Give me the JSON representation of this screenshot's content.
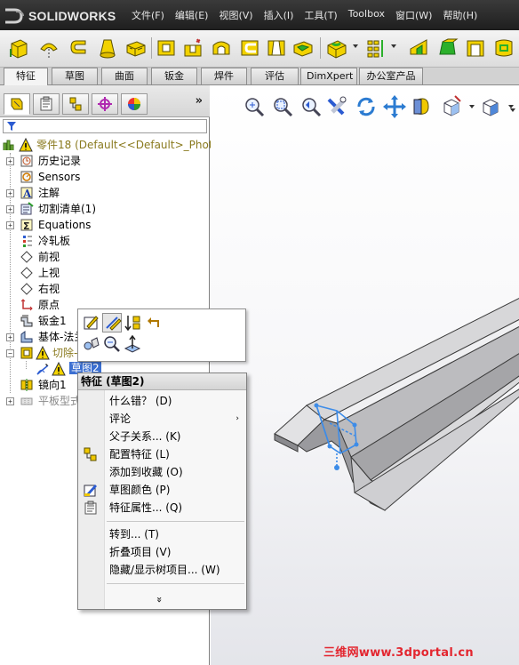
{
  "app": {
    "logo_prefix": "DS",
    "logo_name": "SOLIDWORKS"
  },
  "menu": {
    "items": [
      "文件(F)",
      "编辑(E)",
      "视图(V)",
      "插入(I)",
      "工具(T)",
      "Toolbox",
      "窗口(W)",
      "帮助(H)"
    ]
  },
  "command_tabs": [
    "特征",
    "草图",
    "曲面",
    "钣金",
    "焊件",
    "评估",
    "DimXpert",
    "办公室产品"
  ],
  "panel": {
    "more_glyph": "»",
    "tabs": [
      "feature-manager",
      "property-manager",
      "configuration-manager",
      "dimxpert-manager",
      "display-manager"
    ]
  },
  "tree": {
    "root_label": "零件18  (Default<<Default>_Phote",
    "items": [
      {
        "label": "历史记录"
      },
      {
        "label": "Sensors"
      },
      {
        "label": "注解"
      },
      {
        "label": "切割清单(1)"
      },
      {
        "label": "Equations"
      },
      {
        "label": "冷轧板"
      },
      {
        "label": "前视"
      },
      {
        "label": "上视"
      },
      {
        "label": "右视"
      },
      {
        "label": "原点"
      },
      {
        "label": "钣金1"
      },
      {
        "label": "基体-法兰"
      },
      {
        "label": "切除-"
      },
      {
        "label": "草图2"
      },
      {
        "label": "镜向1"
      },
      {
        "label": "平板型式"
      }
    ]
  },
  "context_menu": {
    "title": "特征 (草图2)",
    "items": [
      {
        "label": "什么错？ (D)"
      },
      {
        "label": "评论"
      },
      {
        "label": "父子关系... (K)"
      },
      {
        "label": "配置特征 (L)"
      },
      {
        "label": "添加到收藏 (O)"
      },
      {
        "label": "草图颜色 (P)"
      },
      {
        "label": "特征属性... (Q)"
      },
      {
        "label": "转到... (T)"
      },
      {
        "label": "折叠项目 (V)"
      },
      {
        "label": "隐藏/显示树项目... (W)"
      }
    ],
    "submenu_glyph": "›",
    "expand_glyph": "»"
  },
  "watermark": "三维网www.3dportal.cn",
  "colors": {
    "accent": "#3b6fd1",
    "toolbar_yellow": "#e8c900",
    "watermark": "#e3262f"
  }
}
